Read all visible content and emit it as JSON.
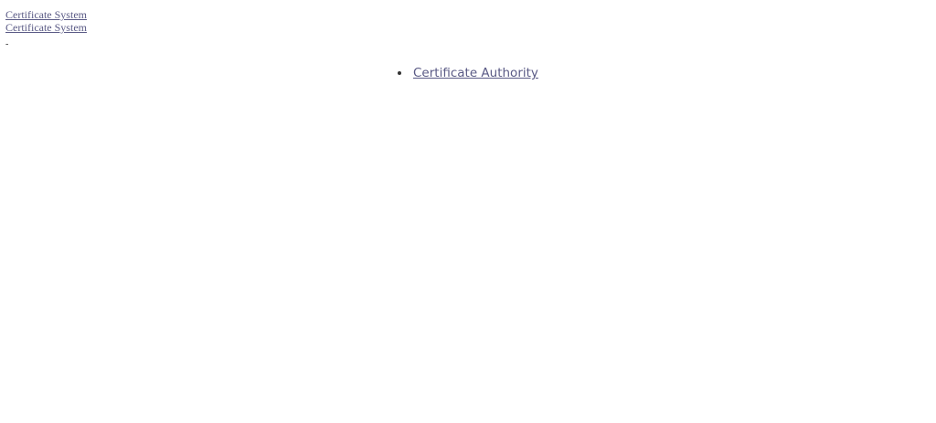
{
  "header": {
    "logo_alt": "Certificate System",
    "title_link": "Certificate System"
  },
  "separator": "-",
  "nav": {
    "items": [
      {
        "label": "Certificate Authority"
      }
    ]
  }
}
